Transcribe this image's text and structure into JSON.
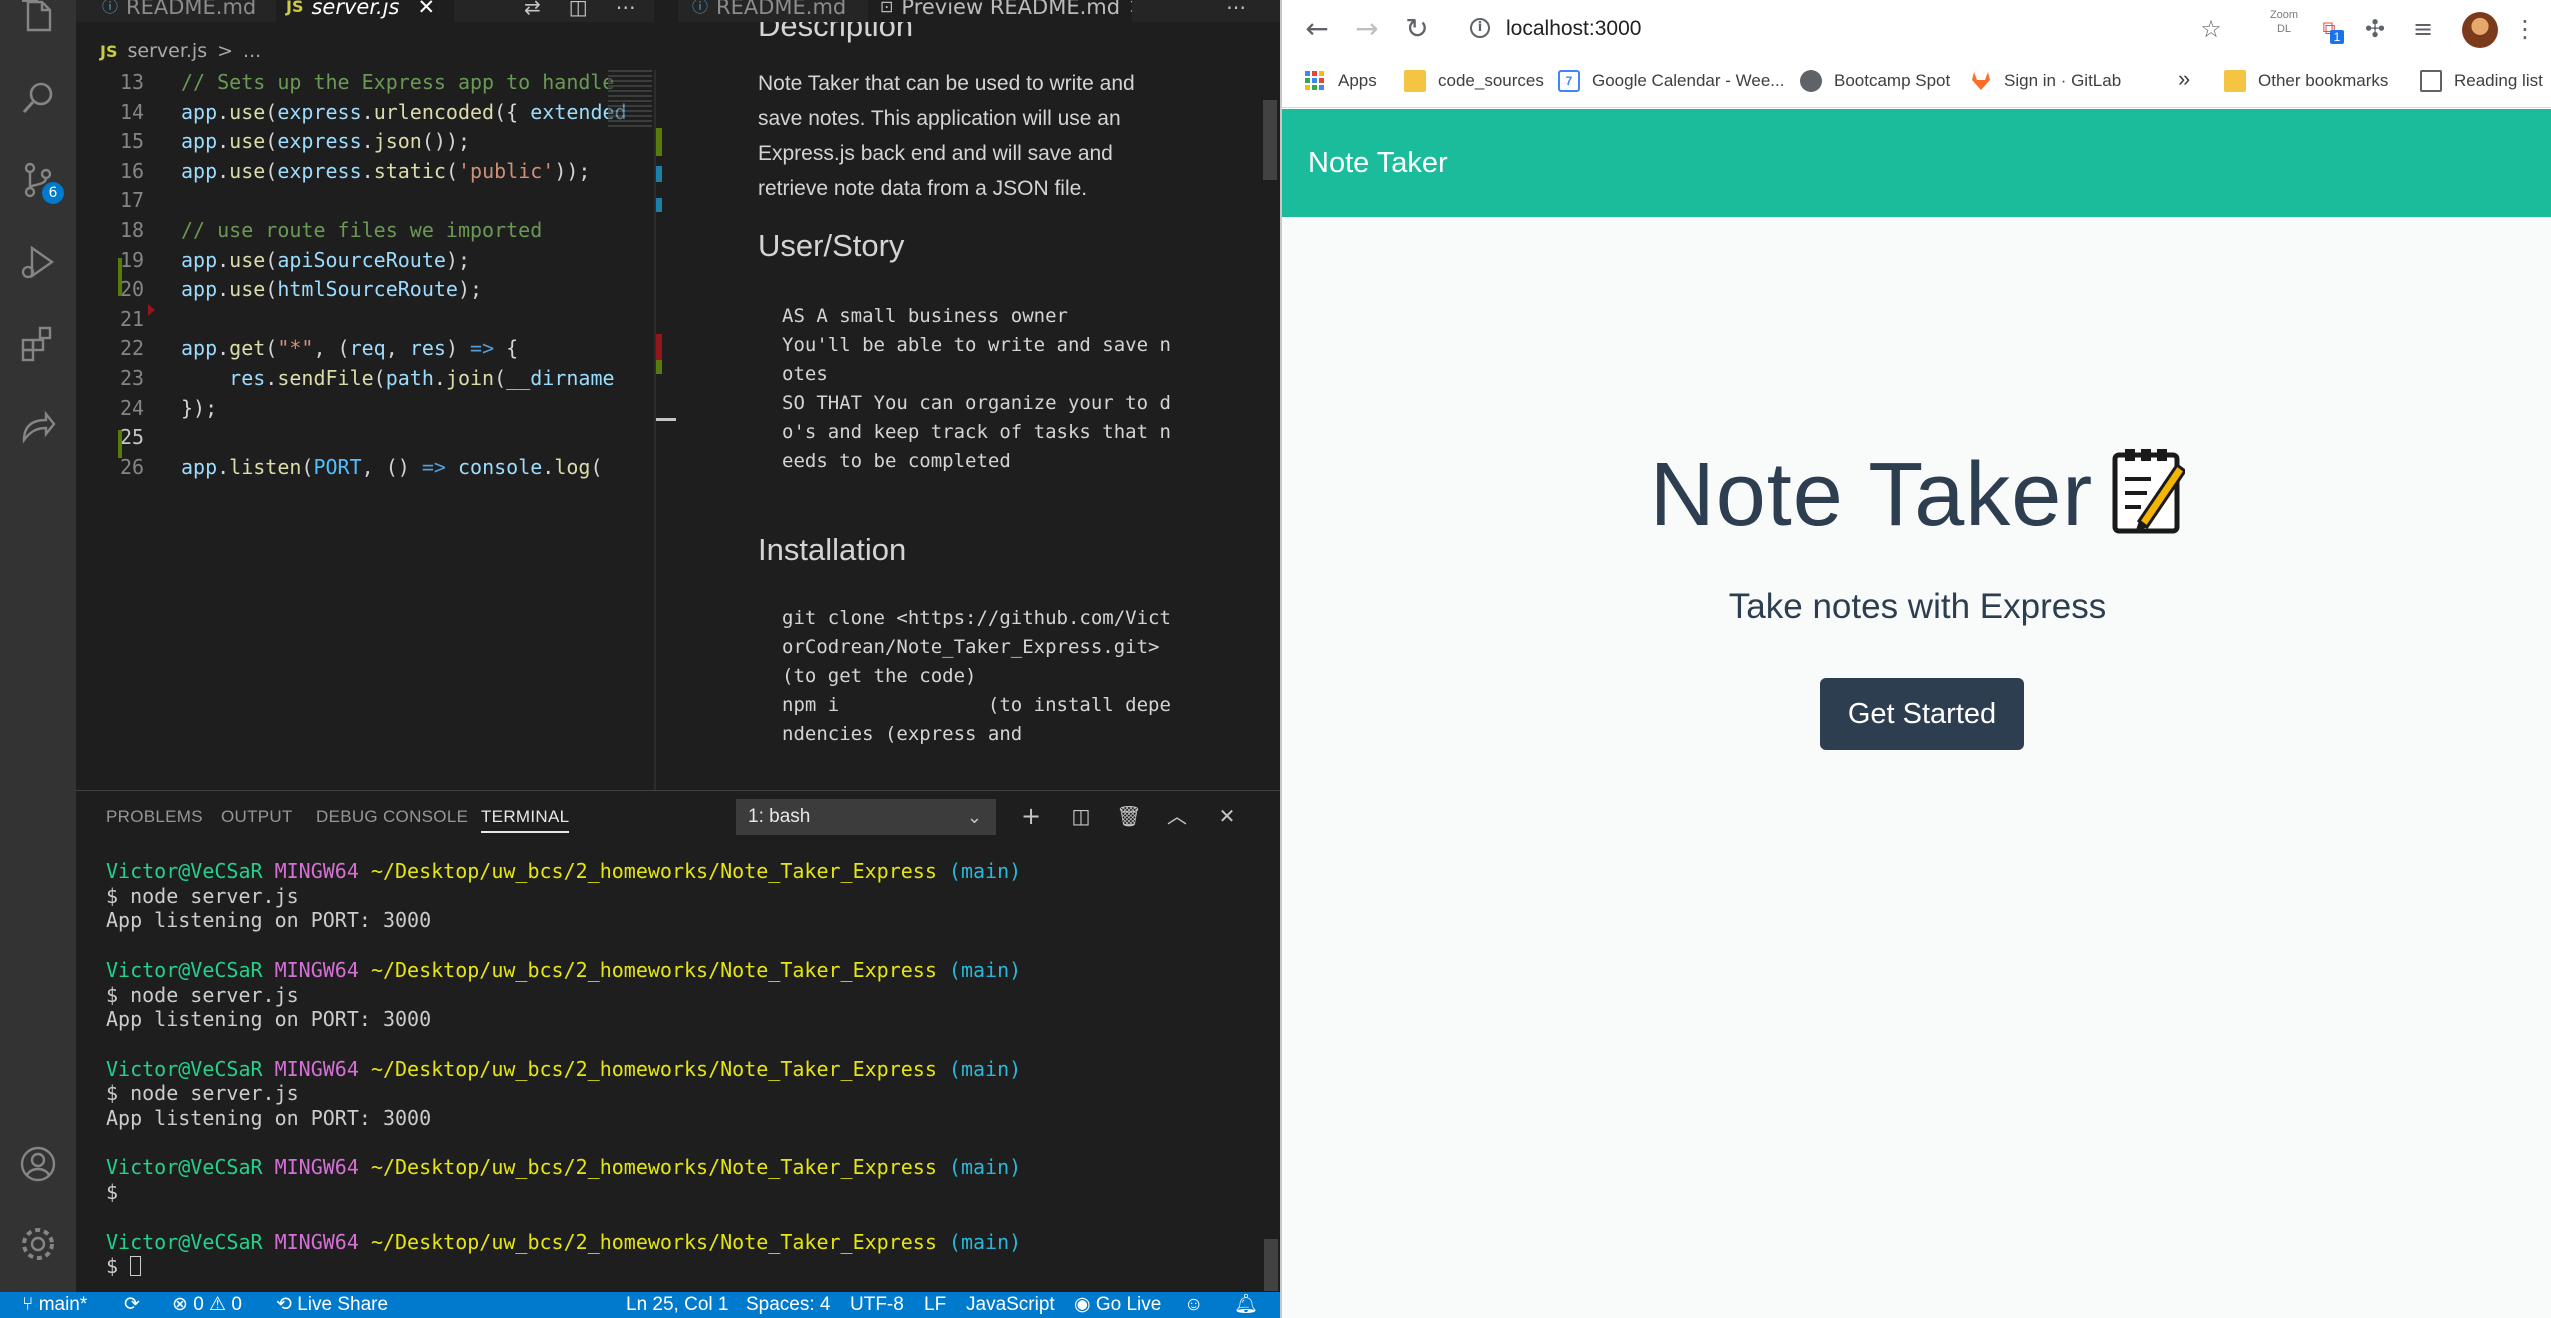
{
  "vscode": {
    "tabs_left": [
      {
        "icon": "ⓘ",
        "label": "README.md",
        "active": false
      },
      {
        "icon": "JS",
        "label": "server.js",
        "active": true
      }
    ],
    "tabs_right": [
      {
        "icon": "ⓘ",
        "label": "README.md",
        "active": false
      },
      {
        "icon": "⊡",
        "label": "Preview README.md",
        "active": true
      }
    ],
    "breadcrumb": {
      "icon": "JS",
      "file": "server.js",
      "sep": ">",
      "rest": "..."
    },
    "scm_badge": "6",
    "editor": {
      "lines": [
        {
          "num": "13",
          "html": "<span class=\"c-cmt\">// Sets up the Express app to handle</span>"
        },
        {
          "num": "14",
          "html": "<span class=\"c-var\">app</span>.<span class=\"c-fn\">use</span>(<span class=\"c-var\">express</span>.<span class=\"c-fn\">urlencoded</span>({ <span class=\"c-var\">extended</span>"
        },
        {
          "num": "15",
          "html": "<span class=\"c-var\">app</span>.<span class=\"c-fn\">use</span>(<span class=\"c-var\">express</span>.<span class=\"c-fn\">json</span>());"
        },
        {
          "num": "16",
          "html": "<span class=\"c-var\">app</span>.<span class=\"c-fn\">use</span>(<span class=\"c-var\">express</span>.<span class=\"c-fn\">static</span>(<span class=\"c-str\">'public'</span>));"
        },
        {
          "num": "17",
          "html": ""
        },
        {
          "num": "18",
          "html": "<span class=\"c-cmt\">// use route files we imported</span>"
        },
        {
          "num": "19",
          "html": "<span class=\"c-var\">app</span>.<span class=\"c-fn\">use</span>(<span class=\"c-var\">apiSourceRoute</span>);"
        },
        {
          "num": "20",
          "html": "<span class=\"c-var\">app</span>.<span class=\"c-fn\">use</span>(<span class=\"c-var\">htmlSourceRoute</span>);"
        },
        {
          "num": "21",
          "html": ""
        },
        {
          "num": "22",
          "html": "<span class=\"c-var\">app</span>.<span class=\"c-fn\">get</span>(<span class=\"c-str\">\"*\"</span>, (<span class=\"c-var\">req</span>, <span class=\"c-var\">res</span>) <span class=\"c-kw\">=></span> {"
        },
        {
          "num": "23",
          "html": "    <span class=\"c-var\">res</span>.<span class=\"c-fn\">sendFile</span>(<span class=\"c-var\">path</span>.<span class=\"c-fn\">join</span>(<span class=\"c-var\">__dirname</span>"
        },
        {
          "num": "24",
          "html": "});"
        },
        {
          "num": "25",
          "html": ""
        },
        {
          "num": "26",
          "html": "<span class=\"c-var\">app</span>.<span class=\"c-fn\">listen</span>(<span class=\"c-const\">PORT</span>, () <span class=\"c-kw\">=></span> <span class=\"c-var\">console</span>.<span class=\"c-fn\">log</span>("
        }
      ]
    },
    "preview": {
      "top_heading": "Description",
      "description": "Note Taker that can be used to write and save notes. This application will use an Express.js back end and will save and retrieve note data from a JSON file.",
      "user_story_heading": "User/Story",
      "user_story": "AS A small business owner\nYou'll be able to write and save notes\nSO THAT You can organize your to do's and keep track of tasks that needs to be completed",
      "installation_heading": "Installation",
      "installation": "git clone <https://github.com/VictorCodrean/Note_Taker_Express.git> (to get the code)\nnpm i             (to install dependencies (express and"
    },
    "panel": {
      "tabs": [
        "PROBLEMS",
        "OUTPUT",
        "DEBUG CONSOLE",
        "TERMINAL"
      ],
      "shell": "1: bash",
      "prompt_user": "Victor@VeCSaR",
      "prompt_host": "MINGW64",
      "prompt_path": "~/Desktop/uw_bcs/2_homeworks/Note_Taker_Express",
      "prompt_branch": "(main)",
      "cmd": "$ node server.js",
      "output": "App listening on PORT: 3000",
      "dollar": "$"
    },
    "statusbar": {
      "branch": "main*",
      "sync": "⟳",
      "errors": "⊗ 0 ⚠ 0",
      "liveshare": "Live Share",
      "position": "Ln 25, Col 1",
      "spaces": "Spaces: 4",
      "encoding": "UTF-8",
      "eol": "LF",
      "language": "JavaScript",
      "golive": "Go Live"
    }
  },
  "chrome": {
    "url": "localhost:3000",
    "zoom_label": "Zoom",
    "zoom_sub": "DL",
    "ext_badge": "1",
    "bookmarks": [
      {
        "icon": "apps",
        "label": "Apps"
      },
      {
        "icon": "folder",
        "label": "code_sources"
      },
      {
        "icon": "calendar",
        "label": "Google Calendar - Wee..."
      },
      {
        "icon": "globe",
        "label": "Bootcamp Spot"
      },
      {
        "icon": "gitlab",
        "label": "Sign in · GitLab"
      }
    ],
    "overflow": "»",
    "other_bookmarks": "Other bookmarks",
    "reading_list": "Reading list"
  },
  "page": {
    "brand": "Note Taker",
    "title": "Note Taker",
    "subtitle": "Take notes with Express",
    "cta": "Get Started"
  }
}
